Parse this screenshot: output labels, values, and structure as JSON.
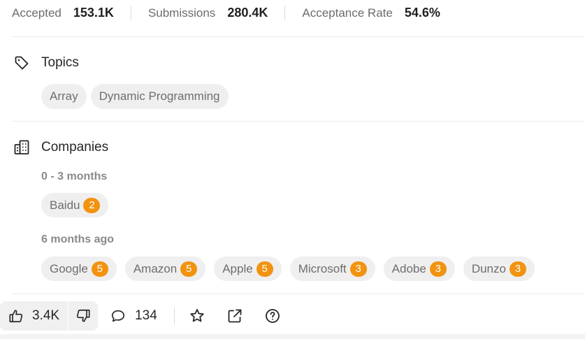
{
  "stats": [
    {
      "label": "Accepted",
      "value": "153.1K"
    },
    {
      "label": "Submissions",
      "value": "280.4K"
    },
    {
      "label": "Acceptance Rate",
      "value": "54.6%"
    }
  ],
  "topics": {
    "title": "Topics",
    "tags": [
      "Array",
      "Dynamic Programming"
    ]
  },
  "companies": {
    "title": "Companies",
    "groups": [
      {
        "period": "0 - 3 months",
        "items": [
          {
            "name": "Baidu",
            "count": "2"
          }
        ]
      },
      {
        "period": "6 months ago",
        "items": [
          {
            "name": "Google",
            "count": "5"
          },
          {
            "name": "Amazon",
            "count": "5"
          },
          {
            "name": "Apple",
            "count": "5"
          },
          {
            "name": "Microsoft",
            "count": "3"
          },
          {
            "name": "Adobe",
            "count": "3"
          },
          {
            "name": "Dunzo",
            "count": "3"
          }
        ]
      }
    ]
  },
  "footer": {
    "likes": "3.4K",
    "comments": "134",
    "icons": [
      "thumbs-up-icon",
      "thumbs-down-icon",
      "comment-icon",
      "star-icon",
      "share-icon",
      "help-icon"
    ]
  },
  "colors": {
    "badge": "#f2930f",
    "chip_bg": "#efefef",
    "divider": "#ebebeb"
  }
}
